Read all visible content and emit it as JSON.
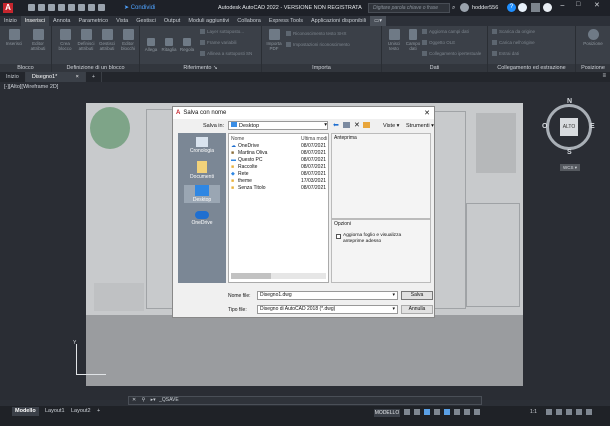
{
  "app": {
    "title": "Autodesk AutoCAD 2022 - VERSIONE NON REGISTRATA",
    "share_label": "Condividi",
    "search_placeholder": "Digitare parola chiave o frase",
    "user": "hodder556"
  },
  "ribbon_tabs": [
    "Inizio",
    "Inserisci",
    "Annota",
    "Parametrico",
    "Vista",
    "Gestisci",
    "Output",
    "Moduli aggiuntivi",
    "Collabora",
    "Express Tools",
    "Applicazioni disponibili"
  ],
  "panels": {
    "blocco": {
      "label": "Blocco",
      "buttons": [
        "Inserisci",
        "Editor attributi"
      ]
    },
    "definizione": {
      "label": "Definizione di un blocco",
      "buttons": [
        "Crea blocco",
        "Definisci attributi",
        "Gestisci attributi",
        "Editor blocchi"
      ]
    },
    "riferimento": {
      "label": "Riferimento",
      "buttons": [
        "Allega",
        "Ritaglia",
        "Regola"
      ],
      "links": [
        "Layer sottoposto...",
        "Frame variabili",
        "Allinea a sottoposti SN"
      ]
    },
    "importa": {
      "label": "Importa",
      "buttons": [
        "Importa PDF"
      ],
      "links": [
        "Riconoscimento testo SHX",
        "Impostazioni riconoscimento"
      ]
    },
    "dati": {
      "label": "Dati",
      "buttons": [
        "Unisci testo",
        "Campo dati"
      ],
      "links": [
        "Aggiorna campi dati",
        "Oggetto OLE",
        "Collegamento ipertestuale"
      ]
    },
    "collegamento": {
      "label": "Collegamento ed estrazione",
      "links": [
        "Scarica da origine",
        "Carica nell'origine",
        "Estrai dati"
      ]
    },
    "posizione": {
      "label": "Posizione",
      "buttons": [
        "Posizione"
      ]
    }
  },
  "file_tabs": [
    "Inizio",
    "Disegno1*"
  ],
  "viewport_label": "[-][Alto][Wireframe 2D]",
  "viewcube": {
    "top": "ALTO",
    "n": "N",
    "s": "S",
    "e": "E",
    "o": "O",
    "wcs": "WCS"
  },
  "dialog": {
    "title": "Salva con nome",
    "save_in_label": "Salva in:",
    "save_in_value": "Desktop",
    "views_label": "Viste",
    "tools_label": "Strumenti",
    "places": [
      "Cronologia",
      "Documenti",
      "Desktop",
      "OneDrive"
    ],
    "columns": {
      "name": "Nome",
      "modified": "Ultima modi"
    },
    "files": [
      {
        "name": "OneDrive",
        "date": "08/07/2021",
        "icon": "cloud-icon"
      },
      {
        "name": "Martina Oliva",
        "date": "08/07/2021",
        "icon": "user-folder-icon"
      },
      {
        "name": "Questo PC",
        "date": "08/07/2021",
        "icon": "pc-icon"
      },
      {
        "name": "Raccolte",
        "date": "08/07/2021",
        "icon": "folder-icon"
      },
      {
        "name": "Rete",
        "date": "08/07/2021",
        "icon": "network-icon"
      },
      {
        "name": "theme",
        "date": "17/03/2021",
        "icon": "folder-icon"
      },
      {
        "name": "Senza Titolo",
        "date": "08/07/2021",
        "icon": "folder-icon"
      }
    ],
    "preview_label": "Anteprima",
    "options_label": "Opzioni",
    "option_checkbox": "Aggiorna foglio e visualizza anteprime adesso",
    "filename_label": "Nome file:",
    "filename_value": "Disegno1.dwg",
    "filetype_label": "Tipo file:",
    "filetype_value": "Disegno di AutoCAD 2018 (*.dwg)",
    "save_label": "Salva",
    "cancel_label": "Annulla"
  },
  "command_line": "_QSAVE",
  "layout_tabs": [
    "Modello",
    "Layout1",
    "Layout2"
  ],
  "status": {
    "mode": "MODELLO",
    "scale": "1:1"
  },
  "colors": {
    "accent": "#1f8fff",
    "panel_bg": "#3b4048",
    "dark_bg": "#1e2128"
  }
}
